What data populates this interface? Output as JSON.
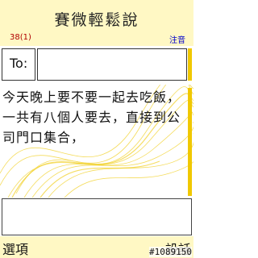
{
  "header": {
    "title": "賽微輕鬆說"
  },
  "status": {
    "char_count": "38(1)",
    "input_mode": "注音"
  },
  "recipient": {
    "label": "To:",
    "value": ""
  },
  "message": {
    "text": "今天晚上要不要一起去吃飯，一共有八個人要去，直接到公司門口集合，"
  },
  "softkeys": {
    "left": "選項",
    "right": "設話"
  },
  "watermark": "#1089150",
  "colors": {
    "accent_yellow": "#f0c800",
    "bar_background": "#fff8c4",
    "char_count": "#b00000",
    "input_mode": "#0000cc"
  }
}
